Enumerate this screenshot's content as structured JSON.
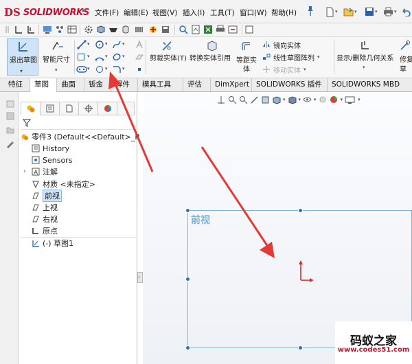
{
  "app": {
    "logo_ds": "DS",
    "logo_name": "SOLIDWORKS"
  },
  "menu": [
    "文件(F)",
    "编辑(E)",
    "视图(V)",
    "插入(I)",
    "工具(T)",
    "窗口(W)",
    "帮助(H)"
  ],
  "command_manager": {
    "exit_sketch": "退出草图",
    "smart_dimension": "智能尺寸",
    "trim_entities": "剪裁实体(T)",
    "convert_entities": "转换实体引用",
    "offset_entities_line1": "等距实",
    "offset_entities_line2": "体",
    "mirror_entities": "镜向实体",
    "linear_pattern": "线性草图阵列",
    "move_entities": "移动实体",
    "display_relations": "显示/删除几何关系",
    "repair_line1": "修复",
    "repair_line2": "草"
  },
  "tabs": [
    {
      "label": "特征"
    },
    {
      "label": "草图"
    },
    {
      "label": "曲面"
    },
    {
      "label": "钣金"
    },
    {
      "label": "焊件"
    },
    {
      "label": "模具工具"
    },
    {
      "label": "评估"
    },
    {
      "label": "DimXpert"
    },
    {
      "label": "SOLIDWORKS 插件"
    },
    {
      "label": "SOLIDWORKS MBD"
    }
  ],
  "active_tab": "草图",
  "tree": {
    "root": "零件3  (Default<<Default>_P",
    "items": [
      {
        "label": "History"
      },
      {
        "label": "Sensors"
      },
      {
        "label": "注解"
      },
      {
        "label": "材质 <未指定>"
      },
      {
        "label": "前视"
      },
      {
        "label": "上视"
      },
      {
        "label": "右视"
      },
      {
        "label": "原点"
      },
      {
        "label": "(-) 草图1"
      }
    ],
    "selected": "前视"
  },
  "viewport": {
    "plane_label": "前视"
  },
  "watermark": {
    "title": "码蚁之家",
    "url": "www.codes51.com"
  },
  "colors": {
    "brand": "#c8102e",
    "selection": "#cde4fb",
    "plane": "#7fb3d8",
    "annotation_arrow": "#e53935",
    "axis": "#d32f2f"
  }
}
